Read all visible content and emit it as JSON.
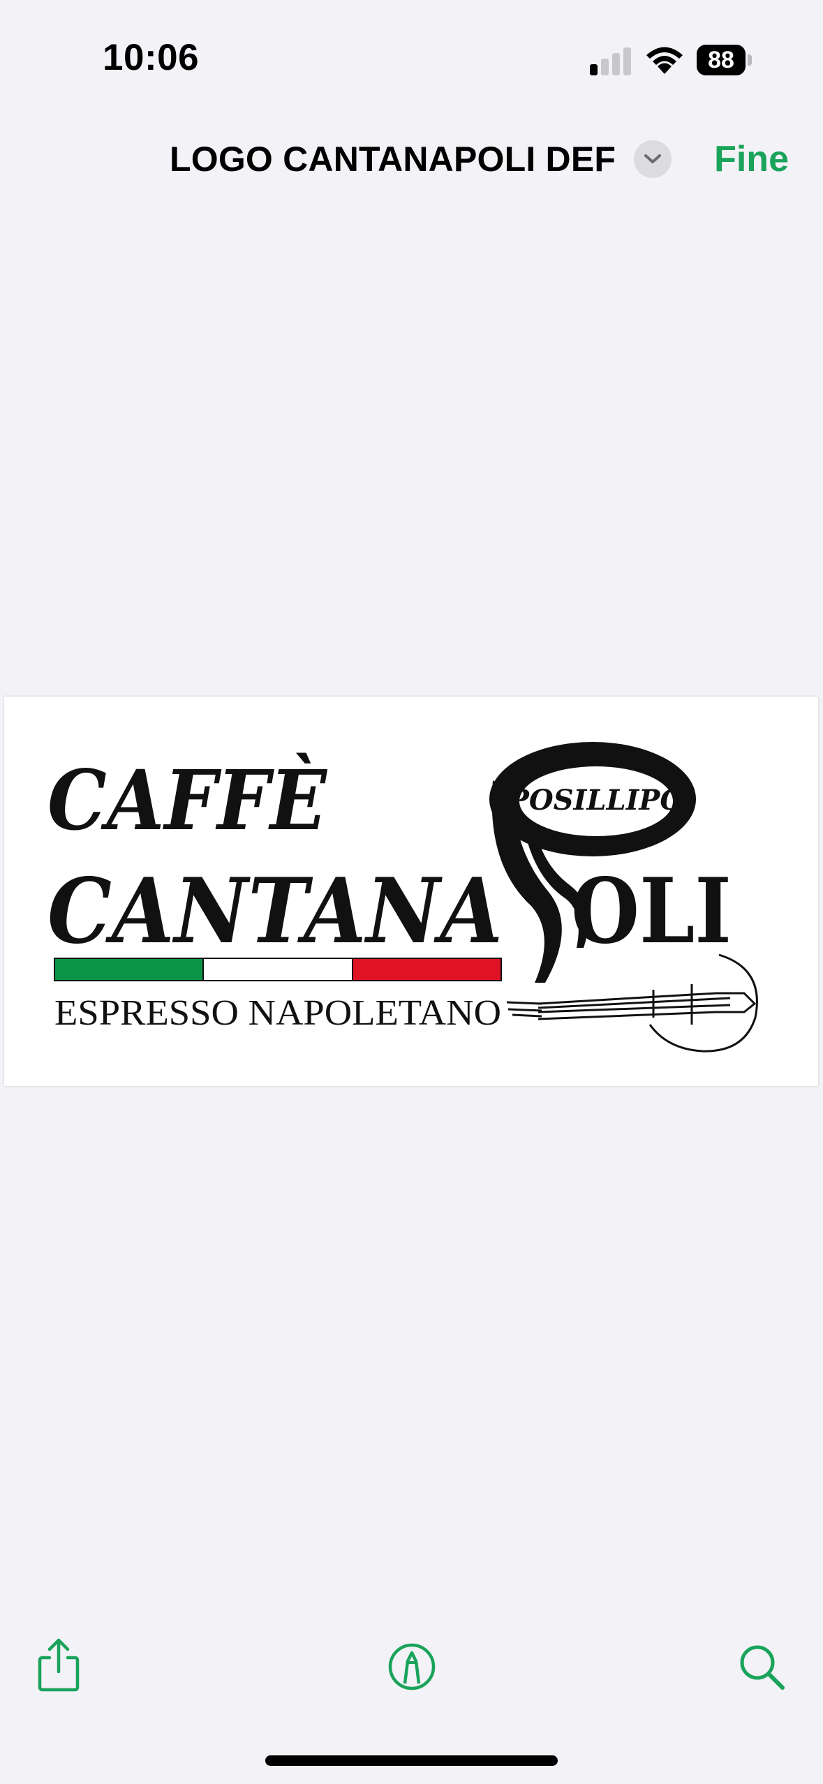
{
  "status_bar": {
    "time": "10:06",
    "battery_level": "88",
    "signal_bars_active": 1,
    "signal_bars_total": 4
  },
  "nav": {
    "title": "LOGO CANTANAPOLI DEF",
    "done_label": "Fine",
    "title_menu_icon": "chevron-down-icon"
  },
  "document": {
    "logo_line1": "CAFFÈ",
    "logo_line2_a": "CANTANA",
    "logo_line2_b": "OLI",
    "logo_badge": "POSILLIPO",
    "logo_subtitle": "ESPRESSO NAPOLETANO",
    "flag_colors": [
      "#0a9447",
      "#ffffff",
      "#e01324"
    ]
  },
  "toolbar": {
    "share_icon": "share-icon",
    "markup_icon": "markup-icon",
    "search_icon": "search-icon"
  },
  "colors": {
    "accent": "#1aa35a",
    "background": "#f2f2f7"
  }
}
